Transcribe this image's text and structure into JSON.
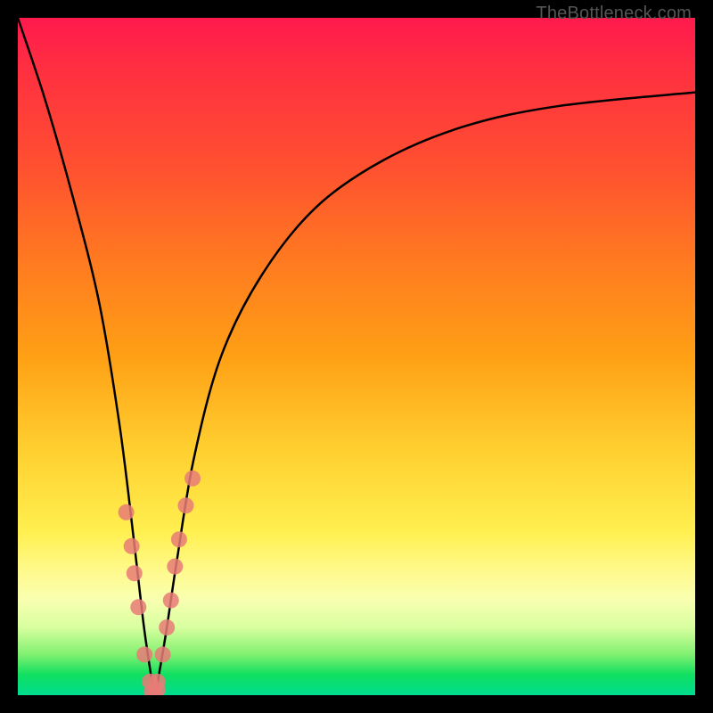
{
  "watermark": "TheBottleneck.com",
  "chart_data": {
    "type": "line",
    "title": "",
    "xlabel": "",
    "ylabel": "",
    "xlim": [
      0,
      100
    ],
    "ylim": [
      0,
      100
    ],
    "grid": false,
    "legend": false,
    "background_gradient": {
      "direction": "vertical",
      "stops": [
        {
          "pos": 0.0,
          "color": "#ff1a4d"
        },
        {
          "pos": 0.5,
          "color": "#ffa015"
        },
        {
          "pos": 0.8,
          "color": "#fff050"
        },
        {
          "pos": 1.0,
          "color": "#00dc90"
        }
      ]
    },
    "series": [
      {
        "name": "bottleneck-curve",
        "type": "line",
        "color": "#000000",
        "x": [
          0,
          4,
          8,
          12,
          15,
          17,
          18.5,
          19.5,
          20.2,
          21,
          22,
          23.5,
          26,
          30,
          36,
          44,
          54,
          66,
          80,
          100
        ],
        "values": [
          100,
          88,
          74,
          58,
          40,
          24,
          11,
          4,
          0,
          4,
          10,
          20,
          35,
          50,
          62,
          72,
          79,
          84,
          87,
          89
        ]
      },
      {
        "name": "left-branch-markers",
        "type": "scatter",
        "color": "#e87b77",
        "x": [
          16.0,
          16.8,
          17.2,
          17.8,
          18.7,
          19.5
        ],
        "values": [
          27,
          22,
          18,
          13,
          6,
          2
        ]
      },
      {
        "name": "right-branch-markers",
        "type": "scatter",
        "color": "#e87b77",
        "x": [
          20.6,
          21.4,
          22.0,
          22.6,
          23.2,
          23.8,
          24.8,
          25.8
        ],
        "values": [
          2,
          6,
          10,
          14,
          19,
          23,
          28,
          32
        ]
      },
      {
        "name": "valley-markers",
        "type": "scatter",
        "color": "#e87b77",
        "x": [
          19.8,
          20.2,
          20.6
        ],
        "values": [
          0.5,
          0.2,
          0.8
        ]
      }
    ]
  }
}
